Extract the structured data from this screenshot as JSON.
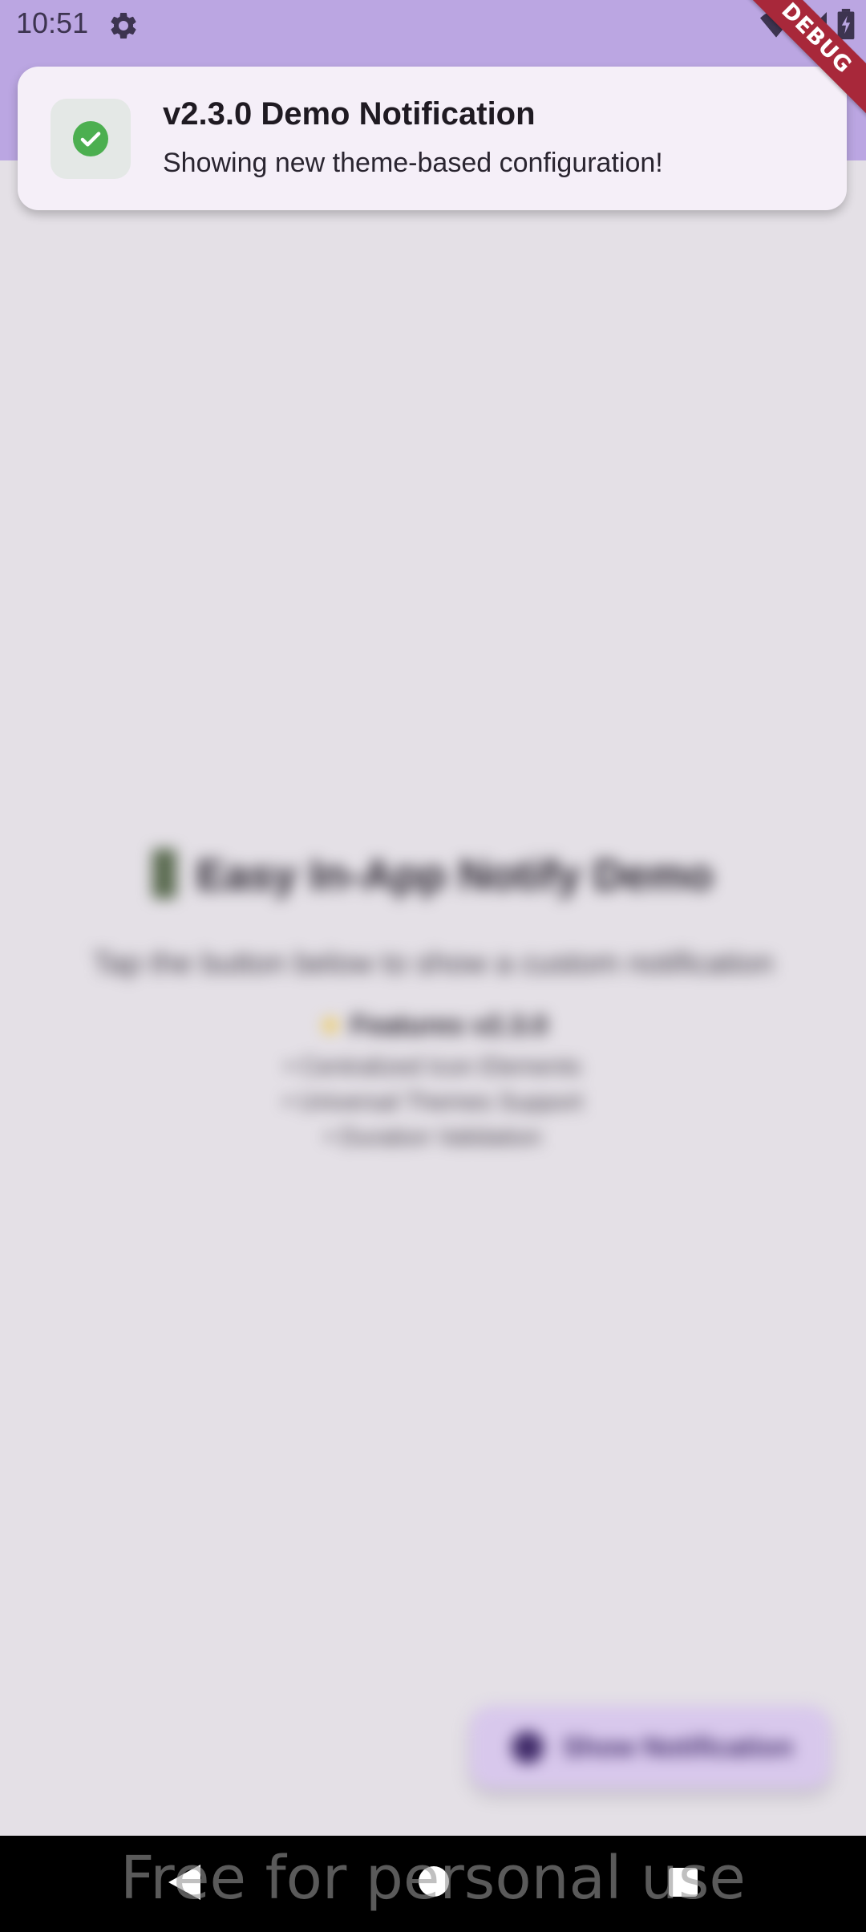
{
  "status_bar": {
    "time": "10:51",
    "background_color": "#bba6e2",
    "icons": [
      "gear-icon",
      "wifi-icon",
      "signal-icon",
      "battery-icon"
    ]
  },
  "debug_banner": {
    "label": "DEBUG",
    "color": "#a8283a"
  },
  "notification": {
    "title": "v2.3.0 Demo Notification",
    "message": "Showing new theme-based configuration!",
    "icon": "check-circle-icon",
    "icon_color": "#4caf50"
  },
  "app": {
    "title": "Easy In-App Notify Demo",
    "subtitle": "Tap the button below to show a custom notification",
    "features_title": "Features v2.3.0",
    "features": [
      "• Centralized Icon Elements",
      "• Universal Themes Support",
      "• Duration Validation"
    ],
    "fab_label": "Show Notification"
  },
  "navigation": {
    "buttons": [
      "back-button",
      "home-button",
      "recents-button"
    ]
  },
  "watermark": "Free for personal use"
}
